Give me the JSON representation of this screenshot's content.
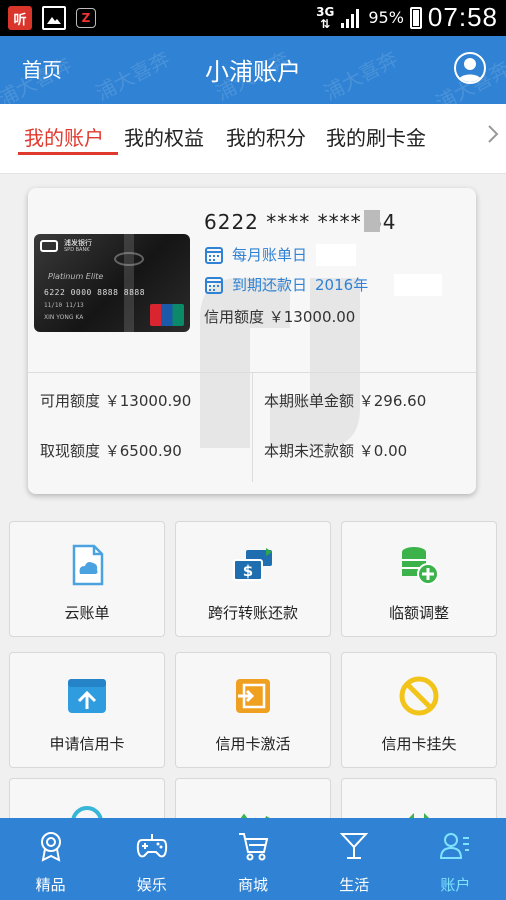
{
  "status_bar": {
    "app_icon_text": "听",
    "network": "3G",
    "battery": "95%",
    "battery_level": 0.95,
    "time": "07:58"
  },
  "header": {
    "home_label": "首页",
    "title": "小浦账户",
    "watermark": "浦大喜奔"
  },
  "tabs": [
    {
      "label": "我的账户",
      "active": true
    },
    {
      "label": "我的权益",
      "active": false
    },
    {
      "label": "我的积分",
      "active": false
    },
    {
      "label": "我的刷卡金",
      "active": false
    }
  ],
  "card": {
    "number": "6222 **** **** 64",
    "bank_name": "浦发银行",
    "bank_en": "SPD BANK",
    "card_series": "Platinum Elite",
    "card_face_number": "6222 0000 8888 8888",
    "card_face_dates": "11/10 11/13",
    "card_face_name": "XIN YONG KA",
    "statement_day_label": "每月账单日",
    "due_date_label": "到期还款日",
    "due_date_value": "2016年",
    "credit_limit": "信用额度 ￥13000.00"
  },
  "stats": {
    "available": "可用额度 ￥13000.90",
    "cash_advance": "取现额度 ￥6500.90",
    "statement_amount": "本期账单金额 ￥296.60",
    "unpaid_amount": "本期未还款额 ￥0.00"
  },
  "tiles": [
    {
      "label": "云账单",
      "icon": "cloud-bill-icon",
      "color": "#4aa3e0"
    },
    {
      "label": "跨行转账还款",
      "icon": "dollar-transfer-icon",
      "color": "#1f6fb0"
    },
    {
      "label": "临额调整",
      "icon": "coin-stack-add-icon",
      "color": "#3cb24a"
    },
    {
      "label": "申请信用卡",
      "icon": "upload-card-icon",
      "color": "#2f9ce0"
    },
    {
      "label": "信用卡激活",
      "icon": "activate-icon",
      "color": "#f0a020"
    },
    {
      "label": "信用卡挂失",
      "icon": "prohibit-icon",
      "color": "#f2c419"
    }
  ],
  "bottom_nav": [
    {
      "label": "精品",
      "icon": "award-icon"
    },
    {
      "label": "娱乐",
      "icon": "gamepad-icon"
    },
    {
      "label": "商城",
      "icon": "cart-icon"
    },
    {
      "label": "生活",
      "icon": "cocktail-icon"
    },
    {
      "label": "账户",
      "icon": "account-icon",
      "active": true
    }
  ],
  "colors": {
    "primary": "#2f82d4",
    "active_tab": "#e03a2f",
    "active_nav": "#7fe3ff"
  }
}
